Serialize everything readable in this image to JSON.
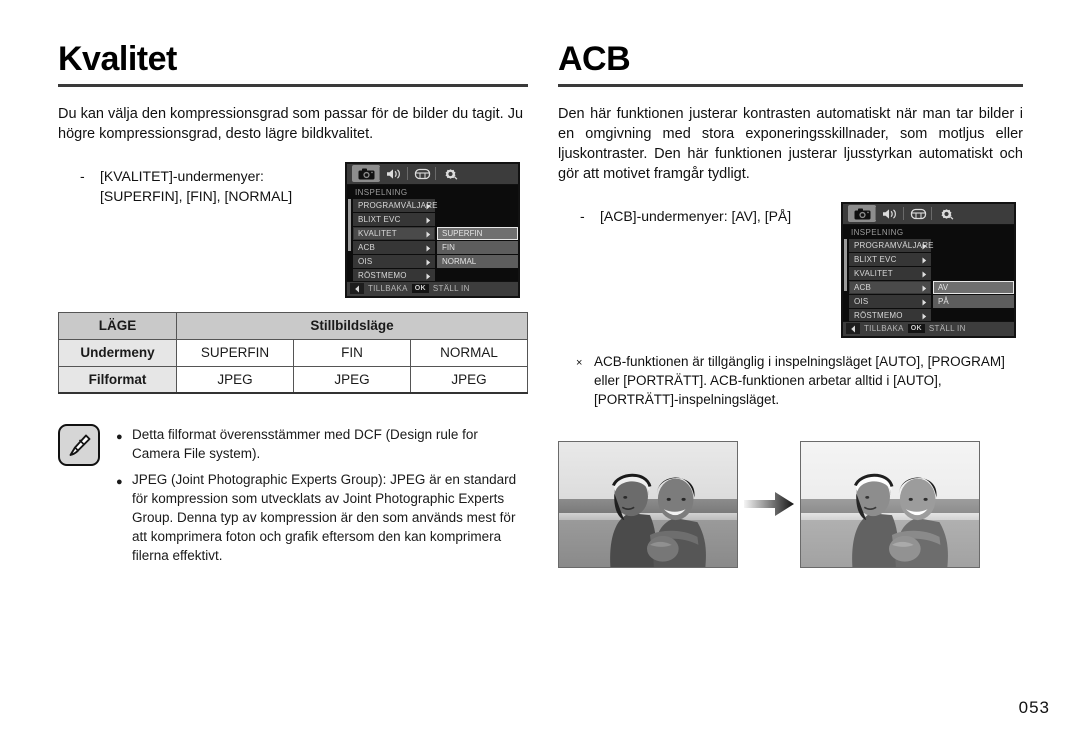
{
  "page": {
    "number": "053"
  },
  "left": {
    "title": "Kvalitet",
    "intro": "Du kan välja den kompressionsgrad som passar för de bilder du tagit. Ju högre kompressionsgrad, desto lägre bildkvalitet.",
    "submenu_note_line1": "[KVALITET]-undermenyer:",
    "submenu_note_line2": "[SUPERFIN], [FIN], [NORMAL]",
    "dash": "-"
  },
  "right": {
    "title": "ACB",
    "intro": "Den här funktionen justerar kontrasten automatiskt när man tar bilder i en omgivning med stora exponeringsskillnader, som motljus eller ljuskontraster. Den här funktionen justerar ljusstyrkan automatiskt och gör att motivet framgår tydligt.",
    "submenu_note": "[ACB]-undermenyer: [AV], [PÅ]",
    "dash": "-",
    "x_mark": "×",
    "footnote": "ACB-funktionen är tillgänglig i inspelningsläget [AUTO], [PROGRAM] eller [PORTRÄTT]. ACB-funktionen arbetar alltid i [AUTO], [PORTRÄTT]-inspelningsläget."
  },
  "lcd_quality": {
    "screen_title": "INSPELNING",
    "tabs": [
      "camera-icon",
      "sound-icon",
      "display-icon",
      "settings-icon"
    ],
    "menu_items": [
      {
        "label": "PROGRAMVÄLJARE",
        "active": false
      },
      {
        "label": "BLIXT EVC",
        "active": false
      },
      {
        "label": "KVALITET",
        "active": true
      },
      {
        "label": "ACB",
        "active": false
      },
      {
        "label": "OIS",
        "active": false
      },
      {
        "label": "RÖSTMEMO",
        "active": false
      }
    ],
    "submenu_items": [
      {
        "label": "SUPERFIN",
        "highlighted": true
      },
      {
        "label": "FIN",
        "highlighted": false
      },
      {
        "label": "NORMAL",
        "highlighted": false
      }
    ],
    "footer_back": "TILLBAKA",
    "footer_ok": "OK",
    "footer_set": "STÄLL IN"
  },
  "lcd_acb": {
    "screen_title": "INSPELNING",
    "tabs": [
      "camera-icon",
      "sound-icon",
      "display-icon",
      "settings-icon"
    ],
    "menu_items": [
      {
        "label": "PROGRAMVÄLJARE",
        "active": false
      },
      {
        "label": "BLIXT EVC",
        "active": false
      },
      {
        "label": "KVALITET",
        "active": false
      },
      {
        "label": "ACB",
        "active": true
      },
      {
        "label": "OIS",
        "active": false
      },
      {
        "label": "RÖSTMEMO",
        "active": false
      }
    ],
    "submenu_items": [
      {
        "label": "AV",
        "highlighted": true
      },
      {
        "label": "PÅ",
        "highlighted": false
      }
    ],
    "footer_back": "TILLBAKA",
    "footer_ok": "OK",
    "footer_set": "STÄLL IN"
  },
  "table": {
    "header_mode_label": "LÄGE",
    "header_mode_value": "Stillbildsläge",
    "rows": [
      {
        "label": "Undermeny",
        "cells": [
          "SUPERFIN",
          "FIN",
          "NORMAL"
        ]
      },
      {
        "label": "Filformat",
        "cells": [
          "JPEG",
          "JPEG",
          "JPEG"
        ]
      }
    ]
  },
  "note": {
    "icon": "note-pen-icon",
    "bullet": "●",
    "items": [
      "Detta filformat överensstämmer med DCF (Design rule for Camera File system).",
      "JPEG (Joint Photographic Experts Group): JPEG är en standard för kompression som utvecklats av Joint Photographic Experts Group. Denna typ av kompression är den som används mest för att komprimera foton och grafik eftersom den kan komprimera filerna effektivt."
    ]
  },
  "photos": {
    "before_alt": "beach-couple-photo-before-acb",
    "after_alt": "beach-couple-photo-after-acb",
    "arrow": "right-arrow-icon"
  },
  "colors": {
    "rule": "#3a3a3a",
    "table_header_bg": "#c9c9c9",
    "table_rowhead_bg": "#e6e6e6",
    "lcd_bg": "#0c0c0c",
    "lcd_menu_bg": "#363636",
    "lcd_sub_bg": "#5d5d5d"
  }
}
